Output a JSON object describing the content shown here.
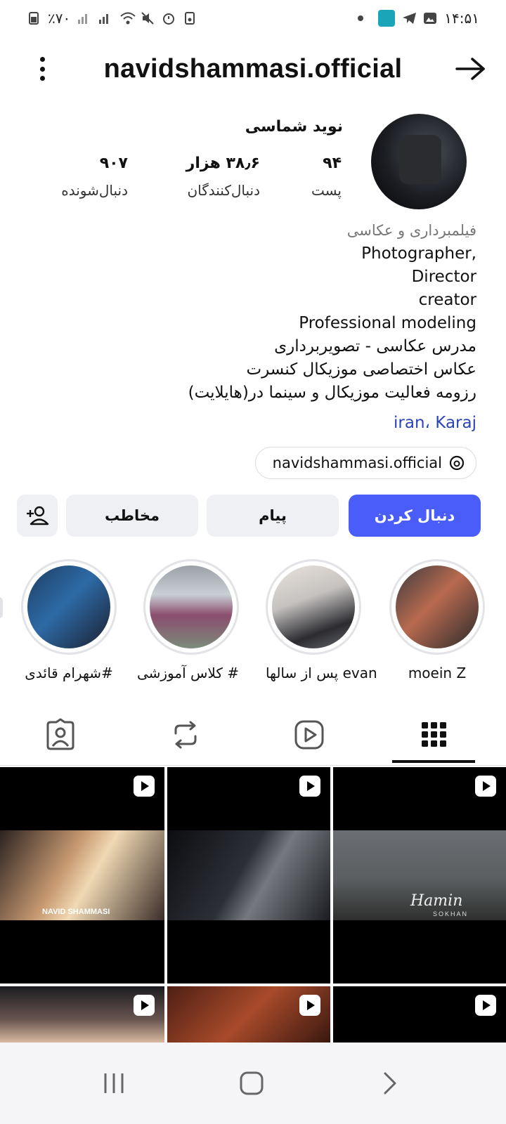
{
  "status_bar": {
    "battery": "٪۷۰",
    "time": "۱۴:۵۱"
  },
  "header": {
    "username": "navidshammasi.official"
  },
  "profile": {
    "display_name": "نوید شماسی",
    "stats": {
      "posts": {
        "value": "۹۴",
        "label": "پست"
      },
      "followers": {
        "value": "۳۸٫۶ هزار",
        "label": "دنبال‌کنندگان"
      },
      "following": {
        "value": "۹۰۷",
        "label": "دنبال‌شونده"
      }
    },
    "bio": {
      "category": "فیلمبرداری و عکاسی",
      "lines": [
        "Photographer,",
        "Director",
        "creator",
        "Professional modeling",
        "مدرس  عکاسی - تصویربرداری",
        "عکاس اختصاصی موزیکال کنسرت",
        "رزومه فعالیت موزیکال و سینما در(هایلایت)"
      ],
      "location_link": "iran، Karaj"
    },
    "threads_handle": "navidshammasi.official"
  },
  "actions": {
    "follow": "دنبال کردن",
    "message": "پیام",
    "contact": "مخاطب"
  },
  "highlights": [
    {
      "label": "moein Z"
    },
    {
      "label": "پس از سالها evan"
    },
    {
      "label": "# کلاس آموزشی"
    },
    {
      "label": "#شهرام قائدی"
    }
  ],
  "tabs": [
    "grid-icon",
    "reels-icon",
    "reposts-icon",
    "tagged-icon"
  ],
  "posts": {
    "watermark_1": "NAVID SHAMMASI",
    "title_3": "Hamin",
    "subtitle_3": "SOKHAN"
  },
  "colors": {
    "accent": "#4a5df9",
    "link": "#2b45b8",
    "button_bg": "#eff0f3"
  }
}
